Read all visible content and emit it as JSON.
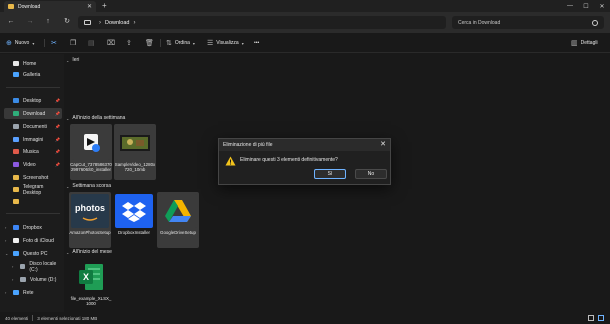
{
  "window": {
    "tab_label": "Download",
    "tab_close": "✕",
    "new_tab": "+",
    "minimize": "—",
    "maximize": "☐",
    "close": "✕"
  },
  "address": {
    "back": "←",
    "forward": "→",
    "up": "↑",
    "refresh": "↻",
    "path_chevron": "›",
    "crumbs": [
      "Download"
    ],
    "search_placeholder": "Cerca in Download"
  },
  "toolbar": {
    "new_label": "Nuovo",
    "sort_label": "Ordina",
    "view_label": "Visualizza",
    "more_label": "•••",
    "details_label": "Dettagli"
  },
  "sidebar": {
    "items": [
      {
        "label": "Home",
        "color": "#e8e8e8"
      },
      {
        "label": "Galleria",
        "color": "#4aa3ff"
      },
      {
        "label": "Desktop",
        "color": "#3b8be6"
      },
      {
        "label": "Download",
        "color": "#2fae7a"
      },
      {
        "label": "Documenti",
        "color": "#9aa3ad"
      },
      {
        "label": "Immagini",
        "color": "#5aa0ff"
      },
      {
        "label": "Musica",
        "color": "#e05a4a"
      },
      {
        "label": "Video",
        "color": "#8c5ae0"
      },
      {
        "label": "Screenshot",
        "color": "#e8b84a"
      },
      {
        "label": "Telegram Desktop",
        "color": "#e8b84a"
      },
      {
        "label": "",
        "color": "#e8b84a"
      },
      {
        "label": "Dropbox",
        "color": "#3d86f5"
      },
      {
        "label": "Foto di iCloud",
        "color": "#f0f0f0"
      },
      {
        "label": "Questo PC",
        "color": "#4aa3ff"
      },
      {
        "label": "Disco locale (C:)",
        "color": "#9aa3ad"
      },
      {
        "label": "Volume (D:)",
        "color": "#9aa3ad"
      },
      {
        "label": "Rete",
        "color": "#4aa3ff"
      }
    ]
  },
  "groups": {
    "yesterday": "Ieri",
    "early_week": "All'inizio della settimana",
    "last_week": "Settimana scorsa",
    "early_month": "All'inizio del mese"
  },
  "files": [
    {
      "name": "CapCut_73785863702997606Ś0_installer"
    },
    {
      "name": "SampleVideo_1280x720_10mb"
    },
    {
      "name": "AmazonPhotosSetup"
    },
    {
      "name": "DropboxInstaller"
    },
    {
      "name": "GoogleDriveSetup"
    },
    {
      "name": "file_example_XLSX_1000"
    }
  ],
  "thumb_text": {
    "amazon_line1": "photos",
    "excel_letter": "X"
  },
  "dialog": {
    "title": "Eliminazione di più file",
    "close": "✕",
    "message": "Eliminare questi 3 elementi definitivamente?",
    "yes": "Sì",
    "no": "No"
  },
  "status": {
    "count": "40 elementi",
    "selected": "3 elementi selezionati  180 MB"
  }
}
